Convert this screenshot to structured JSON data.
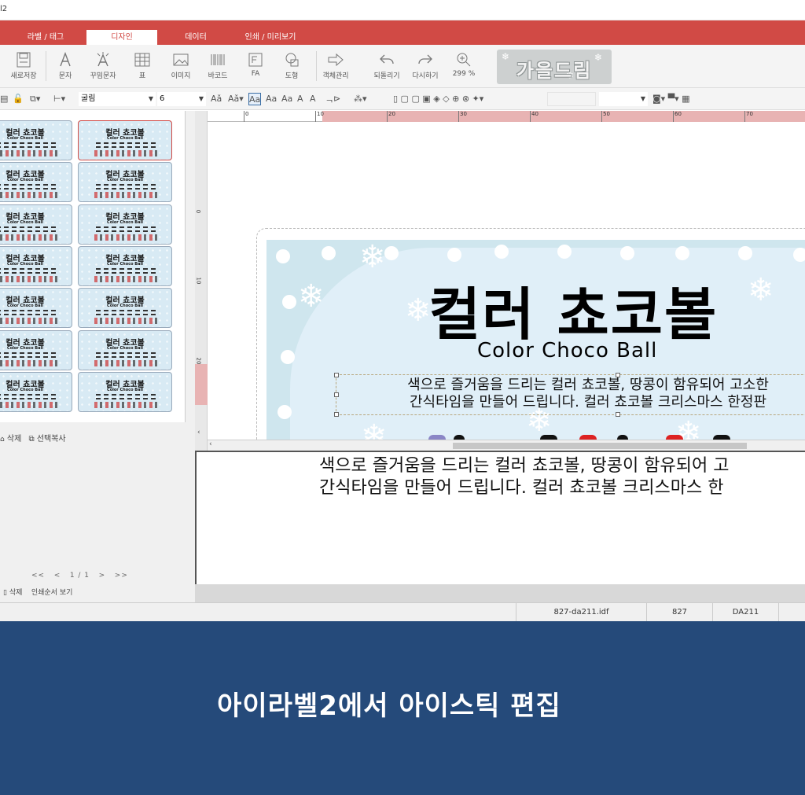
{
  "window": {
    "title": "l2"
  },
  "ribbon": {
    "tabs": [
      {
        "label": "라벨 / 태그"
      },
      {
        "label": "디자인"
      },
      {
        "label": "데이터"
      },
      {
        "label": "인쇄 / 미리보기"
      }
    ],
    "active_tab": "디자인",
    "accent_color": "#d14a45"
  },
  "toolbar": {
    "buttons": [
      {
        "label": "새로저장",
        "icon": "save-icon"
      },
      {
        "label": "문자",
        "icon": "text-icon"
      },
      {
        "label": "꾸밈문자",
        "icon": "decor-text-icon"
      },
      {
        "label": "표",
        "icon": "table-icon"
      },
      {
        "label": "이미지",
        "icon": "image-icon"
      },
      {
        "label": "바코드",
        "icon": "barcode-icon"
      },
      {
        "label": "FA",
        "icon": "fa-icon"
      },
      {
        "label": "도형",
        "icon": "shape-icon"
      },
      {
        "label": "객체관리",
        "icon": "object-manage-icon"
      },
      {
        "label": "되돌리기",
        "icon": "undo-icon"
      },
      {
        "label": "다시하기",
        "icon": "redo-icon"
      },
      {
        "label": "299 %",
        "icon": "zoom-icon"
      }
    ],
    "brand_logo_text": "가을드림"
  },
  "format_bar": {
    "font_name": "굴림",
    "font_size": "6"
  },
  "labels_panel": {
    "thumb_title": "컬러 쵸코볼",
    "thumb_sub": "Color Choco Ball",
    "delete_label": "삭제",
    "copy_selected_label": "선택복사",
    "pager": {
      "first": "<<",
      "prev": "<",
      "page": "1 / 1",
      "next": ">",
      "last": ">>"
    },
    "bottom_delete_label": "삭제",
    "print_order_label": "인쇄순서 보기"
  },
  "ruler": {
    "ticks": [
      "0",
      "10",
      "20",
      "30",
      "40",
      "50",
      "60",
      "70"
    ]
  },
  "vertical_ruler": {
    "ticks": [
      "0",
      "10",
      "20"
    ]
  },
  "label_design": {
    "title": "컬러 쵸코볼",
    "subtitle": "Color Choco Ball",
    "description": "색으로 즐거움을 드리는 컬러 쵸코볼, 땅콩이 함유되어 고소한\n간식타임을 만들어 드립니다. 컬러 쵸코볼 크리스마스 한정판"
  },
  "text_editor": {
    "content": "색으로 즐거움을 드리는 컬러 쵸코볼, 땅콩이 함유되어 고\n간식타임을 만들어 드립니다. 컬러 쵸코볼 크리스마스 한"
  },
  "status_bar": {
    "file": "827-da211.idf",
    "code": "827",
    "model": "DA211"
  },
  "caption": {
    "text": "아이라벨2에서 아이스틱 편집",
    "bg_color": "#254a7a"
  }
}
